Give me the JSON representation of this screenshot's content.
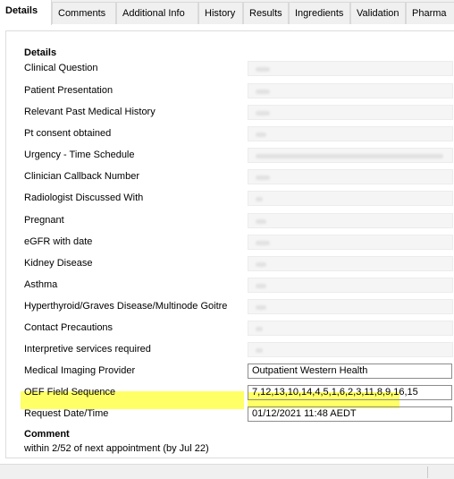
{
  "tabs": [
    {
      "label": "Details",
      "active": true
    },
    {
      "label": "Comments"
    },
    {
      "label": "Additional Info"
    },
    {
      "label": "History"
    },
    {
      "label": "Results"
    },
    {
      "label": "Ingredients"
    },
    {
      "label": "Validation"
    },
    {
      "label": "Pharma"
    }
  ],
  "details": {
    "heading": "Details",
    "fields": [
      {
        "label": "Clinical Question"
      },
      {
        "label": "Patient Presentation"
      },
      {
        "label": "Relevant Past Medical History"
      },
      {
        "label": "Pt consent obtained"
      },
      {
        "label": "Urgency - Time Schedule"
      },
      {
        "label": "Clinician Callback Number"
      },
      {
        "label": "Radiologist Discussed With"
      },
      {
        "label": "Pregnant"
      },
      {
        "label": "eGFR with date"
      },
      {
        "label": "Kidney Disease"
      },
      {
        "label": "Asthma"
      },
      {
        "label": "Hyperthyroid/Graves Disease/Multinode Goitre"
      },
      {
        "label": "Contact Precautions"
      },
      {
        "label": "Interpretive services required"
      },
      {
        "label": "Medical Imaging Provider",
        "value": "Outpatient Western Health"
      },
      {
        "label": "OEF Field Sequence",
        "value": "7,12,13,10,14,4,5,1,6,2,3,11,8,9,16,15"
      },
      {
        "label": "Request Date/Time",
        "value": "01/12/2021 11:48 AEDT"
      }
    ]
  },
  "comment": {
    "heading": "Comment",
    "text": "within 2/52 of next appointment (by Jul 22)"
  },
  "colors": {
    "highlight": "#ffff66",
    "tab_bg": "#f0f0f0"
  }
}
